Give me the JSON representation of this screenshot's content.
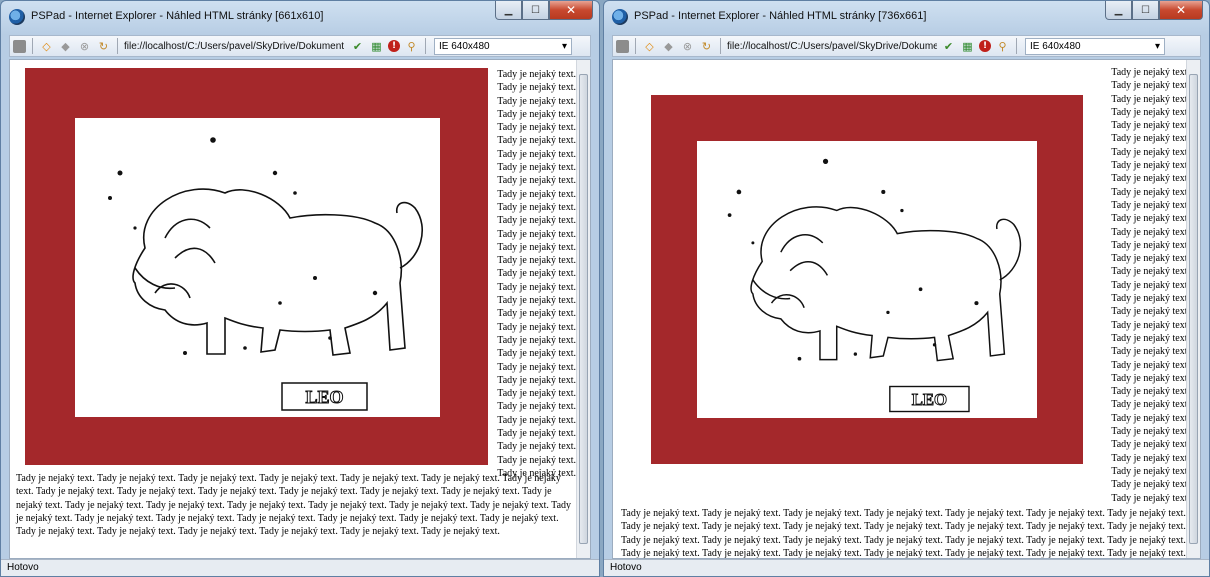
{
  "windows": [
    {
      "title": "PSPad - Internet Explorer - Náhled HTML stránky  [661x610]",
      "url": "file://localhost/C:/Users/pavel/SkyDrive/Dokument",
      "resolution": "IE 640x480",
      "status": "Hotovo",
      "image_label": "LEO",
      "side_line": "Tady je nejaký text.",
      "bottom_text": "Tady je nejaký text. Tady je nejaký text. Tady je nejaký text. Tady je nejaký text. Tady je nejaký text. Tady je nejaký text. Tady je nejaký text. Tady je nejaký text. Tady je nejaký text. Tady je nejaký text. Tady je nejaký text. Tady je nejaký text. Tady je nejaký text. Tady je nejaký text. Tady je nejaký text. Tady je nejaký text. Tady je nejaký text. Tady je nejaký text. Tady je nejaký text. Tady je nejaký text. Tady je nejaký text. Tady je nejaký text. Tady je nejaký text. Tady je nejaký text. Tady je nejaký text. Tady je nejaký text. Tady je nejaký text. Tady je nejaký text. Tady je nejaký text. Tady je nejaký text. Tady je nejaký text. Tady je nejaký text. Tady je nejaký text."
    },
    {
      "title": "PSPad - Internet Explorer - Náhled HTML stránky  [736x661]",
      "url": "file://localhost/C:/Users/pavel/SkyDrive/Dokument",
      "resolution": "IE 640x480",
      "status": "Hotovo",
      "image_label": "LEO",
      "side_line": "Tady je nejaký text.",
      "bottom_text": "Tady je nejaký text. Tady je nejaký text. Tady je nejaký text. Tady je nejaký text. Tady je nejaký text. Tady je nejaký text. Tady je nejaký text. Tady je nejaký text. Tady je nejaký text. Tady je nejaký text. Tady je nejaký text. Tady je nejaký text. Tady je nejaký text. Tady je nejaký text. Tady je nejaký text. Tady je nejaký text. Tady je nejaký text. Tady je nejaký text. Tady je nejaký text. Tady je nejaký text. Tady je nejaký text. Tady je nejaký text. Tady je nejaký text. Tady je nejaký text. Tady je nejaký text. Tady je nejaký text. Tady je nejaký text. Tady je nejaký text."
    }
  ],
  "icons": [
    "ie-logo-icon",
    "stop-icon",
    "back-icon",
    "forward-icon",
    "stop-load-icon",
    "refresh-icon",
    "validate-icon",
    "table-icon",
    "error-icon",
    "find-icon",
    "dropdown-arrow-icon",
    "minimize-icon",
    "maximize-icon",
    "close-icon"
  ],
  "colors": {
    "frame": "#a4282b",
    "window_chrome": "#b7cde4"
  }
}
